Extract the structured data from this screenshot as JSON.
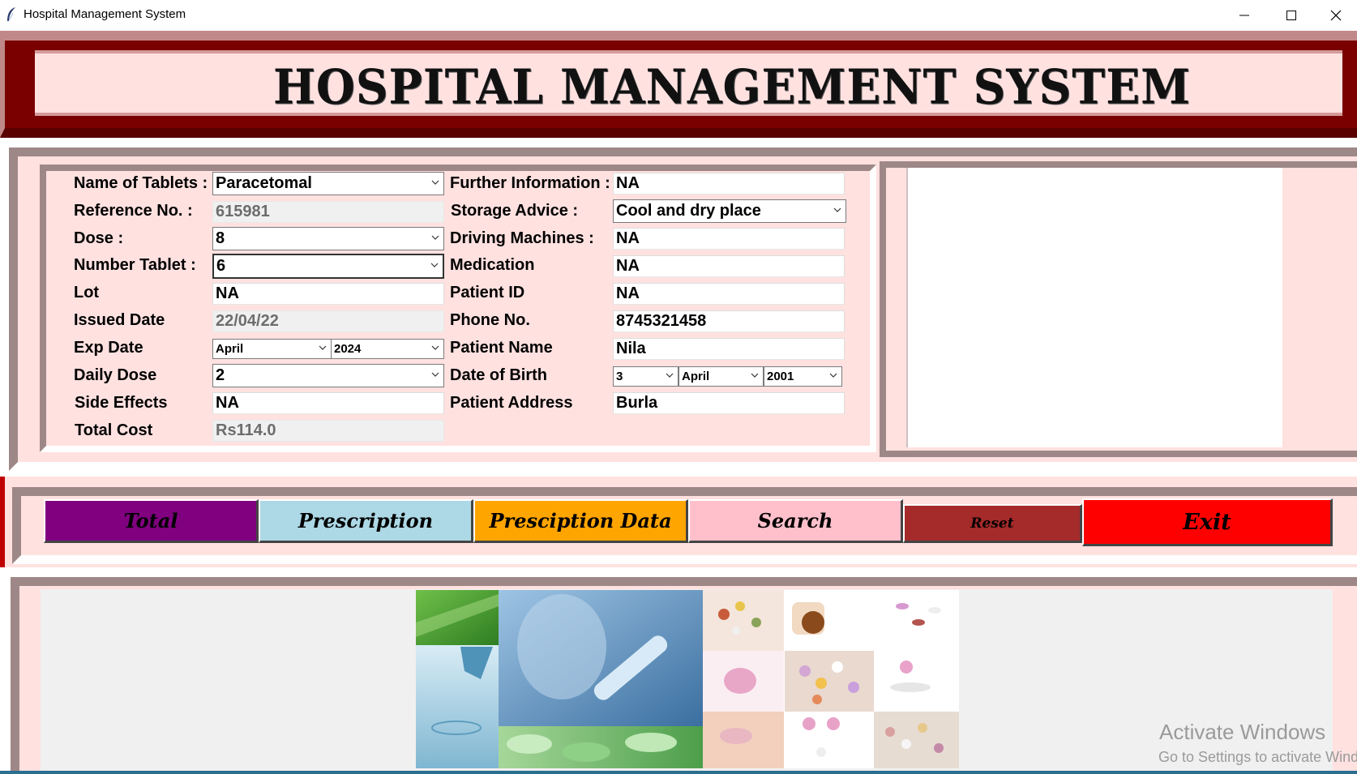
{
  "window": {
    "title": "Hospital Management System",
    "controls": [
      "minimize",
      "maximize",
      "close"
    ]
  },
  "header": {
    "title": "HOSPITAL MANAGEMENT SYSTEM"
  },
  "left_form": {
    "tablet_name_label": "Name of Tablets :",
    "tablet_name_value": "Paracetomal",
    "reference_label": "Reference No. :",
    "reference_value": "615981",
    "dose_label": "Dose :",
    "dose_value": "8",
    "number_tablet_label": "Number Tablet :",
    "number_tablet_value": "6",
    "lot_label": "Lot",
    "lot_value": "NA",
    "issued_date_label": "Issued Date",
    "issued_date_value": "22/04/22",
    "exp_date_label": "Exp Date",
    "exp_month_value": "April",
    "exp_year_value": "2024",
    "daily_dose_label": "Daily Dose",
    "daily_dose_value": "2",
    "side_effects_label": "Side Effects",
    "side_effects_value": "NA",
    "total_cost_label": "Total Cost",
    "total_cost_value": "Rs114.0"
  },
  "right_form": {
    "further_info_label": "Further Information :",
    "further_info_value": "NA",
    "storage_label": "Storage Advice :",
    "storage_value": "Cool and dry place",
    "driving_label": "Driving Machines :",
    "driving_value": "NA",
    "medication_label": "Medication",
    "medication_value": "NA",
    "patient_id_label": "Patient ID",
    "patient_id_value": "NA",
    "phone_label": "Phone No.",
    "phone_value": "8745321458",
    "patient_name_label": "Patient Name",
    "patient_name_value": "Nila",
    "dob_label": "Date of Birth",
    "dob_day_value": "3",
    "dob_month_value": "April",
    "dob_year_value": "2001",
    "address_label": "Patient Address",
    "address_value": "Burla"
  },
  "buttons": {
    "total": "Total",
    "prescription": "Prescription",
    "prescription_data": "Presciption Data",
    "search": "Search",
    "reset": "Reset",
    "exit": "Exit"
  },
  "colors": {
    "total_btn": "#800080",
    "prescription_btn": "#add8e6",
    "prescription_data_btn": "#ffa500",
    "search_btn": "#ffc0cb",
    "reset_btn": "#a52a2a",
    "exit_btn": "#ff0000",
    "panel_bg": "#ffe1e0",
    "header_border": "#7a0000"
  },
  "watermark": {
    "line1": "Activate Windows",
    "line2": "Go to Settings to activate Windows."
  }
}
